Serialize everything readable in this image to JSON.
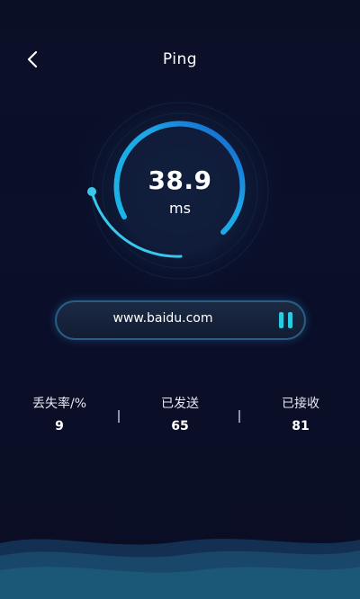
{
  "header": {
    "title": "Ping"
  },
  "gauge": {
    "value": "38.9",
    "unit": "ms"
  },
  "url_bar": {
    "url": "www.baidu.com"
  },
  "stats": [
    {
      "label": "丢失率/%",
      "value": "9"
    },
    {
      "label": "已发送",
      "value": "65"
    },
    {
      "label": "已接收",
      "value": "81"
    }
  ],
  "colors": {
    "accent": "#28cce2",
    "ring_dark": "#1666c9",
    "background": "#0b0f26"
  },
  "icons": {
    "back": "chevron-left-icon",
    "pause": "pause-icon"
  }
}
